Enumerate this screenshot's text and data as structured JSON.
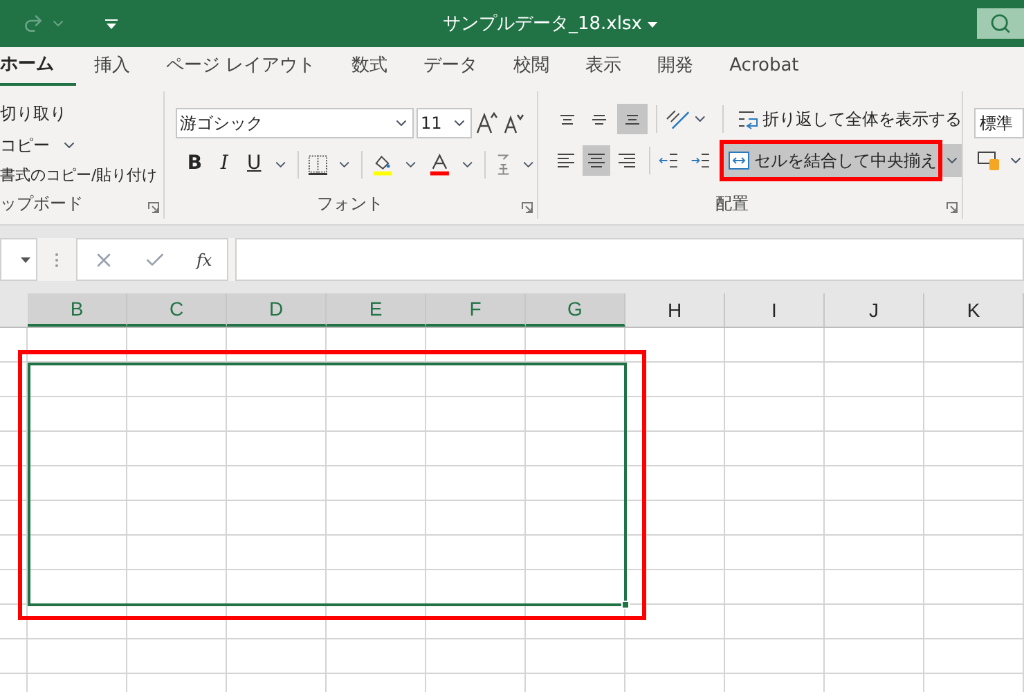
{
  "title_bar": {
    "file_name": "サンプルデータ_18.xlsx"
  },
  "tabs": [
    {
      "label": "ホーム",
      "selected": true
    },
    {
      "label": "挿入",
      "selected": false
    },
    {
      "label": "ページ レイアウト",
      "selected": false
    },
    {
      "label": "数式",
      "selected": false
    },
    {
      "label": "データ",
      "selected": false
    },
    {
      "label": "校閲",
      "selected": false
    },
    {
      "label": "表示",
      "selected": false
    },
    {
      "label": "開発",
      "selected": false
    },
    {
      "label": "Acrobat",
      "selected": false
    }
  ],
  "clipboard": {
    "items": [
      "切り取り",
      "コピー",
      "書式のコピー/貼り付け"
    ],
    "label": "ップボード"
  },
  "font": {
    "font_name": "游ゴシック",
    "font_size": "11",
    "label": "フォント",
    "style_buttons": [
      {
        "kind": "bold",
        "label": "B"
      },
      {
        "kind": "italic",
        "label": "I"
      },
      {
        "kind": "underline",
        "label": "U"
      }
    ]
  },
  "alignment": {
    "vertical": [
      {
        "kind": "top",
        "selected": false
      },
      {
        "kind": "middle",
        "selected": false
      },
      {
        "kind": "bottom",
        "selected": true
      }
    ],
    "horizontal": [
      {
        "kind": "left",
        "selected": false
      },
      {
        "kind": "center",
        "selected": true
      },
      {
        "kind": "right",
        "selected": false
      }
    ],
    "wrap_text": "折り返して全体を表示する",
    "merge": {
      "label": "セルを結合して中央揃え",
      "selected": true,
      "highlighted": true
    },
    "label": "配置"
  },
  "number": {
    "format": "標準"
  },
  "formula_bar": {
    "function_label": "fx"
  },
  "columns": [
    {
      "label": "B",
      "selected": true
    },
    {
      "label": "C",
      "selected": true
    },
    {
      "label": "D",
      "selected": true
    },
    {
      "label": "E",
      "selected": true
    },
    {
      "label": "F",
      "selected": true
    },
    {
      "label": "G",
      "selected": true
    },
    {
      "label": "H",
      "selected": false
    },
    {
      "label": "I",
      "selected": false
    },
    {
      "label": "J",
      "selected": false
    },
    {
      "label": "K",
      "selected": false
    }
  ],
  "selection": {
    "highlighted": true
  }
}
